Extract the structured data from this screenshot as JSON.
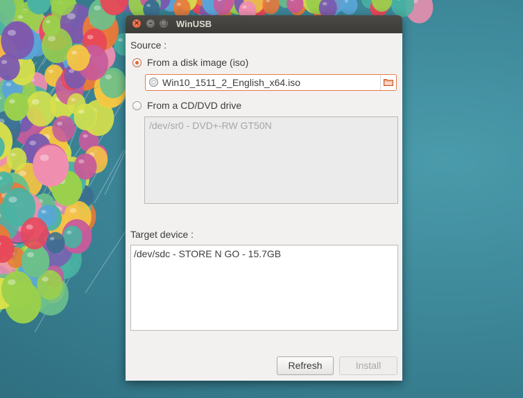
{
  "window": {
    "title": "WinUSB",
    "controls": {
      "close": "×",
      "minimize": "–",
      "maximize": "□"
    }
  },
  "source": {
    "label": "Source :",
    "iso_option_label": "From a disk image (iso)",
    "iso_selected": true,
    "iso_file": "Win10_1511_2_English_x64.iso",
    "cd_option_label": "From a CD/DVD drive",
    "cd_selected": false,
    "cd_drives": [
      "/dev/sr0 - DVD+-RW GT50N"
    ]
  },
  "target": {
    "label": "Target device :",
    "devices": [
      "/dev/sdc - STORE N GO - 15.7GB"
    ]
  },
  "buttons": {
    "refresh": "Refresh",
    "install": "Install"
  },
  "icons": {
    "disc": "disc-icon",
    "folder": "folder-icon"
  },
  "colors": {
    "accent": "#e0642c",
    "titlebar": "#3c3b37",
    "desktop": "#3d8597"
  }
}
